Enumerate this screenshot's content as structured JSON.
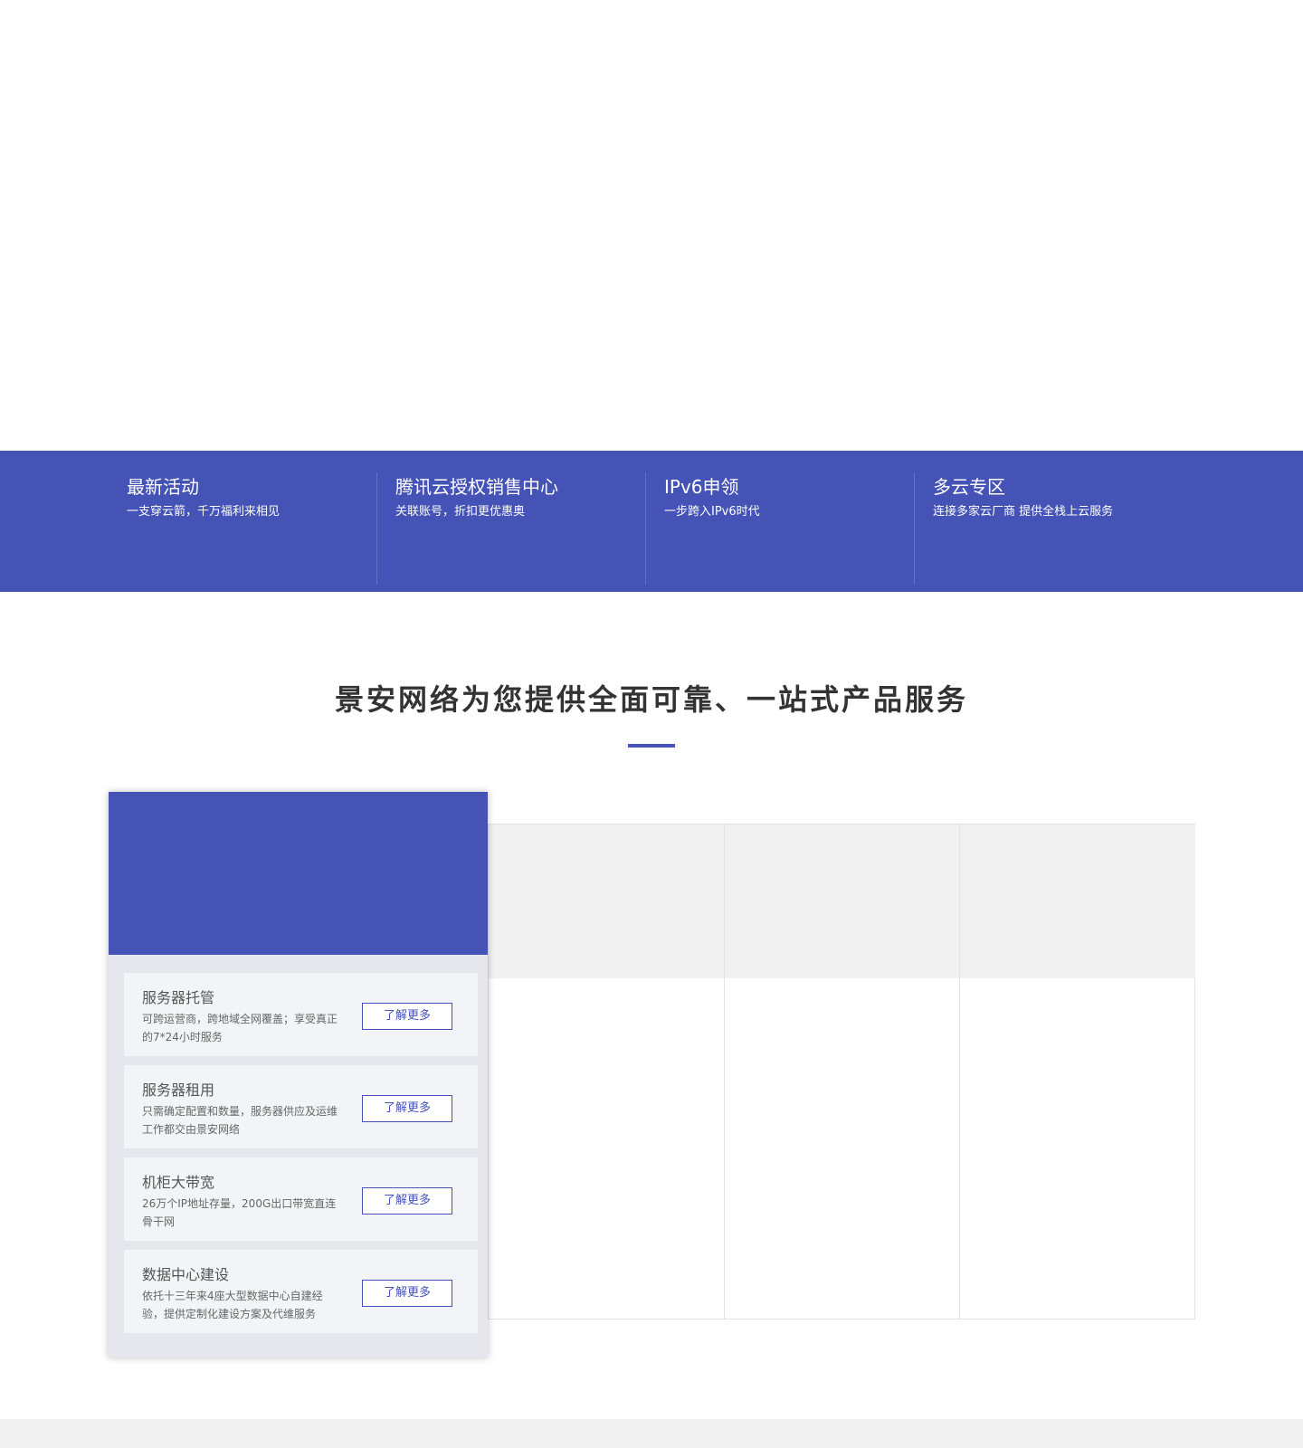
{
  "promos": [
    {
      "title": "最新活动",
      "subtitle": "一支穿云箭，千万福利来相见"
    },
    {
      "title": "腾讯云授权销售中心",
      "subtitle": "关联账号，折扣更优惠奥"
    },
    {
      "title": "IPv6申领",
      "subtitle": "一步跨入IPv6时代"
    },
    {
      "title": "多云专区",
      "subtitle": "连接多家云厂商 提供全栈上云服务"
    }
  ],
  "section": {
    "title": "景安网络为您提供全面可靠、一站式产品服务"
  },
  "services": [
    {
      "title": "服务器托管",
      "desc": "可跨运营商，跨地域全网覆盖；享受真正的7*24小时服务",
      "button": "了解更多"
    },
    {
      "title": "服务器租用",
      "desc": "只需确定配置和数量，服务器供应及运维工作都交由景安网络",
      "button": "了解更多"
    },
    {
      "title": "机柜大带宽",
      "desc": "26万个IP地址存量，200G出口带宽直连骨干网",
      "button": "了解更多"
    },
    {
      "title": "数据中心建设",
      "desc": "依托十三年来4座大型数据中心自建经验，提供定制化建设方案及代维服务",
      "button": "了解更多"
    }
  ],
  "colors": {
    "brand": "#4453b5",
    "panel_bg": "#e6e7ec",
    "card_bg": "#f3f4f8"
  }
}
